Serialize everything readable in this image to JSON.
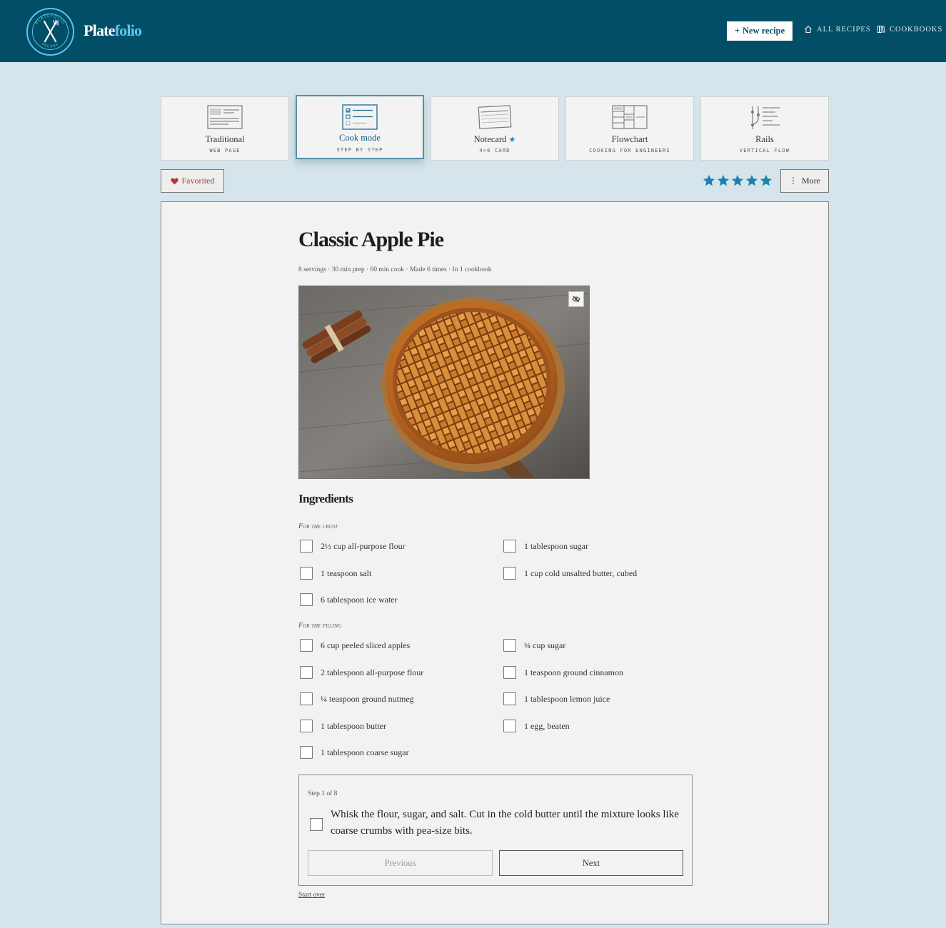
{
  "app": {
    "brand_part1": "Plate",
    "brand_part2": "folio",
    "badge_top": "PLATEFOLIO",
    "badge_bottom": "RECIPES"
  },
  "header": {
    "new_recipe": "New recipe",
    "nav": [
      {
        "label": "All recipes",
        "icon": "home-icon"
      },
      {
        "label": "Cookbooks",
        "icon": "books-icon"
      }
    ]
  },
  "views": [
    {
      "label": "Traditional",
      "sub": "Web page",
      "icon": "webpage-icon",
      "active": false
    },
    {
      "label": "Cook mode",
      "sub": "Step by step",
      "icon": "checklist-icon",
      "active": true
    },
    {
      "label": "Notecard",
      "sub": "4×6 card",
      "icon": "notecard-icon",
      "active": false,
      "starred": true
    },
    {
      "label": "Flowchart",
      "sub": "Cooking for engineers",
      "icon": "flowchart-icon",
      "active": false
    },
    {
      "label": "Rails",
      "sub": "Vertical flow",
      "icon": "rails-icon",
      "active": false
    }
  ],
  "actions": {
    "favorite": "Favorited",
    "rating": 5,
    "more": "More"
  },
  "colors": {
    "header_bg": "#024e66",
    "page_bg": "#d6e5eb",
    "accent": "#1b82b3",
    "favorite": "#b03a30"
  },
  "recipe": {
    "title": "Classic Apple Pie",
    "meta": "8 servings · 30 min prep · 60 min cook · Made 6 times · In 1 cookbook",
    "ingredients_heading": "Ingredients",
    "groups": [
      {
        "title": "For the crust",
        "items": [
          "2½ cup all-purpose flour",
          "1 tablespoon sugar",
          "1 teaspoon salt",
          "1 cup cold unsalted butter, cubed",
          "6 tablespoon ice water"
        ]
      },
      {
        "title": "For the filling",
        "items": [
          "6 cup peeled sliced apples",
          "¾ cup sugar",
          "2 tablespoon all-purpose flour",
          "1 teaspoon ground cinnamon",
          "¼ teaspoon ground nutmeg",
          "1 tablespoon lemon juice",
          "1 tablespoon butter",
          "1 egg, beaten",
          "1 tablespoon coarse sugar"
        ]
      }
    ]
  },
  "step": {
    "counter": "Step 1 of 8",
    "text": "Whisk the flour, sugar, and salt. Cut in the cold butter until the mixture looks like coarse crumbs with pea-size bits.",
    "previous": "Previous",
    "next": "Next",
    "start_over": "Start over"
  }
}
